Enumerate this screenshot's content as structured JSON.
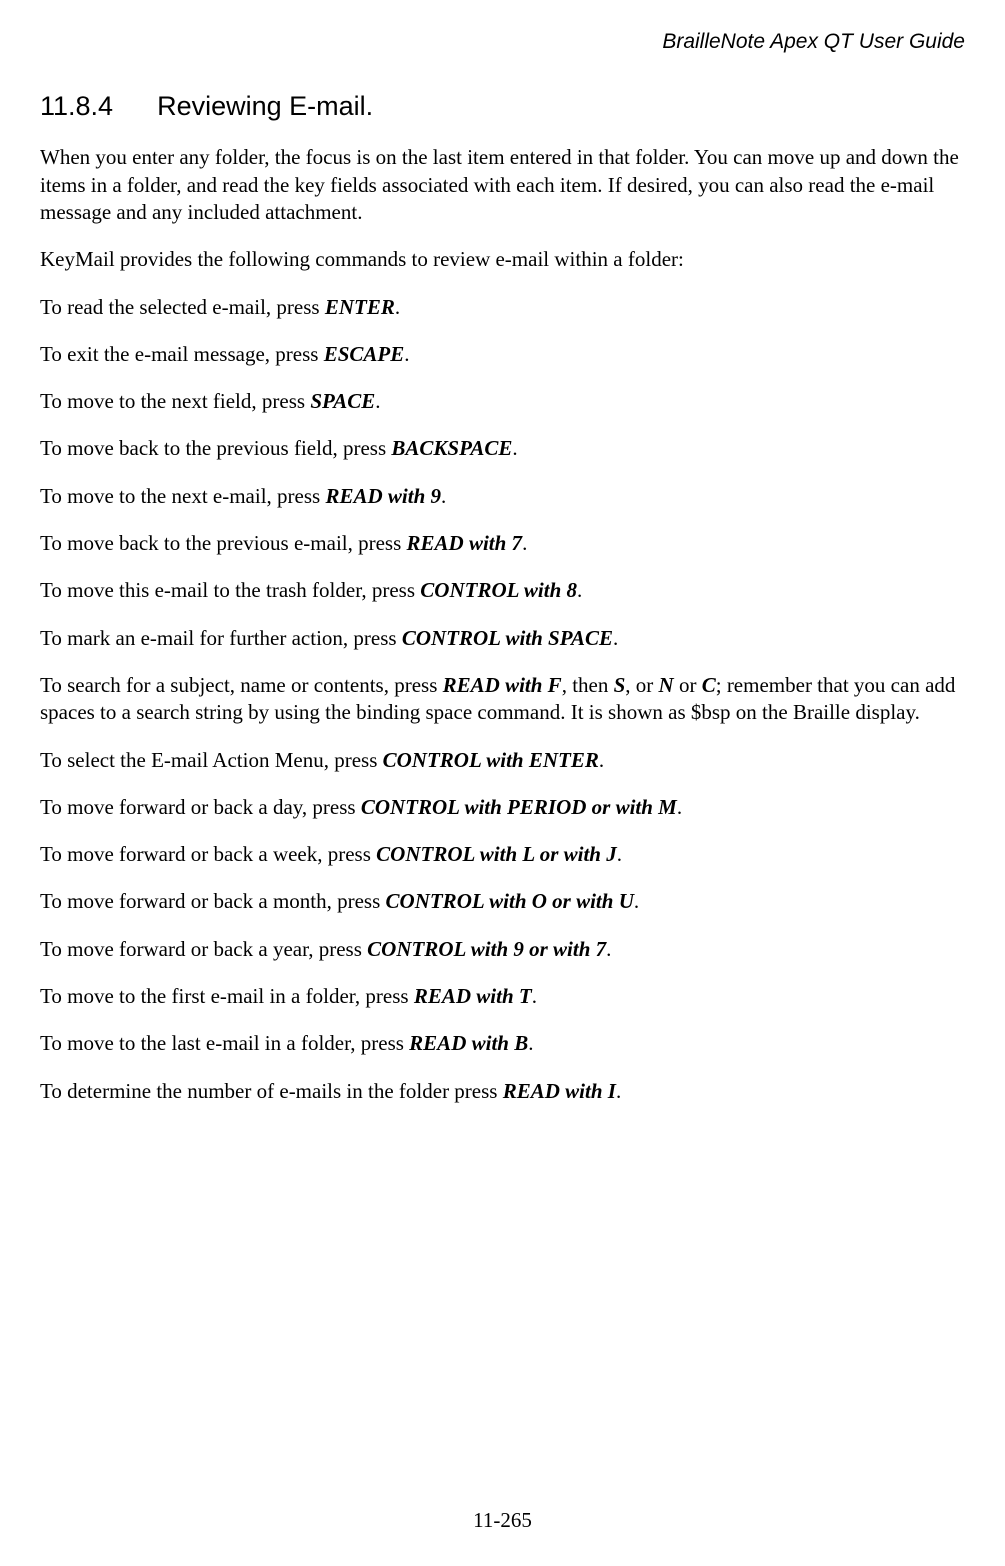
{
  "header": {
    "running_title": "BrailleNote Apex QT User Guide"
  },
  "section": {
    "number": "11.8.4",
    "title": "Reviewing E-mail."
  },
  "body": {
    "intro1": "When you enter any folder, the focus is on the last item entered in that folder. You can move up and down the items in a folder, and read the key fields associated with each item. If desired, you can also read the e-mail message and any included attachment.",
    "intro2": "KeyMail provides the following commands to review e-mail within a folder:",
    "cmd1_pre": "To read the selected e-mail, press ",
    "cmd1_key": "ENTER",
    "cmd2_pre": "To exit the e-mail message, press ",
    "cmd2_key": "ESCAPE",
    "cmd3_pre": "To move to the next field, press ",
    "cmd3_key": "SPACE",
    "cmd4_pre": "To move back to the previous field, press ",
    "cmd4_key": "BACKSPACE",
    "cmd5_pre": "To move to the next e-mail, press ",
    "cmd5_key": "READ with 9",
    "cmd6_pre": "To move back to the previous e-mail, press ",
    "cmd6_key": "READ with 7",
    "cmd7_pre": "To move this e-mail to the trash folder, press ",
    "cmd7_key": "CONTROL with 8",
    "cmd8_pre": "To mark an e-mail for further action, press ",
    "cmd8_key": "CONTROL with SPACE",
    "cmd9_pre": "To search for a subject, name or contents, press ",
    "cmd9_key1": "READ with F",
    "cmd9_mid1": ", then ",
    "cmd9_key2": "S",
    "cmd9_mid2": ", or ",
    "cmd9_key3": "N",
    "cmd9_mid3": " or ",
    "cmd9_key4": "C",
    "cmd9_post": "; remember that you can add spaces to a search string by using the binding space command. It is shown as $bsp on the Braille display.",
    "cmd10_pre": "To select the E-mail Action Menu, press ",
    "cmd10_key": "CONTROL with ENTER",
    "cmd11_pre": "To move forward or back a day, press ",
    "cmd11_key": "CONTROL with PERIOD or with M",
    "cmd12_pre": "To move forward or back a week, press ",
    "cmd12_key": "CONTROL with L or with J",
    "cmd13_pre": "To move forward or back a month, press ",
    "cmd13_key": "CONTROL with O or with U",
    "cmd14_pre": "To move forward or back a year, press ",
    "cmd14_key": "CONTROL with 9 or with 7",
    "cmd15_pre": "To move to the first e-mail in a folder, press ",
    "cmd15_key": "READ with T",
    "cmd16_pre": "To move to the last e-mail in a folder, press ",
    "cmd16_key": "READ with B",
    "cmd17_pre": "To determine the number of e-mails in the folder press ",
    "cmd17_key": "READ with I",
    "period": "."
  },
  "footer": {
    "page_number": "11-265"
  }
}
